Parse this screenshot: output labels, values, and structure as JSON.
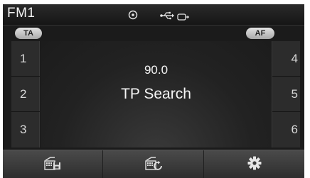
{
  "status_bar": {
    "band": "FM1",
    "icons": [
      "cd-icon",
      "usb-icon",
      "aux-icon"
    ]
  },
  "buttons": {
    "ta": "TA",
    "af": "AF"
  },
  "presets": {
    "left": [
      "1",
      "2",
      "3"
    ],
    "right": [
      "4",
      "5",
      "6"
    ]
  },
  "display": {
    "frequency": "90.0",
    "rds_text": "TP Search"
  },
  "bottom_bar": {
    "icons": [
      "save-preset-icon",
      "scan-icon",
      "gear-icon"
    ]
  },
  "colors": {
    "background": "#1b1b1b",
    "text": "#f5f5f5",
    "pill": "#c8c8c8"
  }
}
